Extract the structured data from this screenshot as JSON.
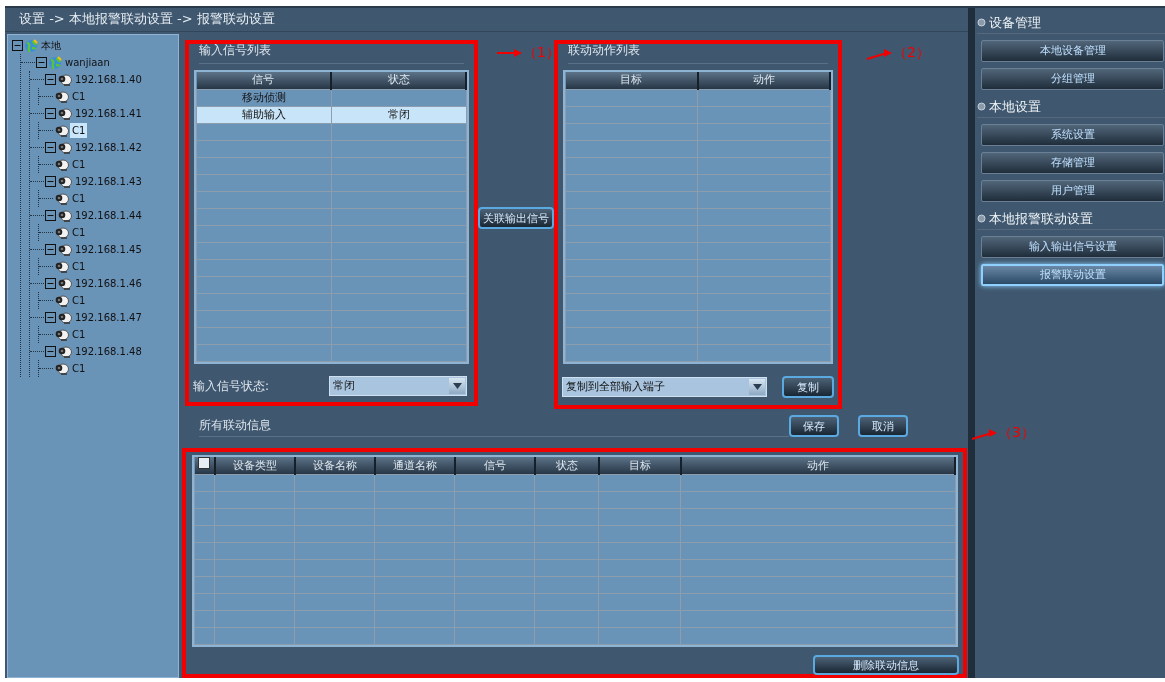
{
  "breadcrumb": "设置 -> 本地报警联动设置 -> 报警联动设置",
  "tree": [
    {
      "label": "本地",
      "kind": "site",
      "expanded": true,
      "selected": false,
      "children": [
        {
          "label": "wanjiaan",
          "kind": "site",
          "expanded": true,
          "selected": false,
          "children": [
            {
              "label": "192.168.1.40",
              "kind": "device",
              "expanded": true,
              "selected": false,
              "children": [
                {
                  "label": "C1",
                  "kind": "channel",
                  "selected": false
                }
              ]
            },
            {
              "label": "192.168.1.41",
              "kind": "device",
              "expanded": true,
              "selected": false,
              "children": [
                {
                  "label": "C1",
                  "kind": "channel",
                  "selected": true
                }
              ]
            },
            {
              "label": "192.168.1.42",
              "kind": "device",
              "expanded": true,
              "selected": false,
              "children": [
                {
                  "label": "C1",
                  "kind": "channel",
                  "selected": false
                }
              ]
            },
            {
              "label": "192.168.1.43",
              "kind": "device",
              "expanded": true,
              "selected": false,
              "children": [
                {
                  "label": "C1",
                  "kind": "channel",
                  "selected": false
                }
              ]
            },
            {
              "label": "192.168.1.44",
              "kind": "device",
              "expanded": true,
              "selected": false,
              "children": [
                {
                  "label": "C1",
                  "kind": "channel",
                  "selected": false
                }
              ]
            },
            {
              "label": "192.168.1.45",
              "kind": "device",
              "expanded": true,
              "selected": false,
              "children": [
                {
                  "label": "C1",
                  "kind": "channel",
                  "selected": false
                }
              ]
            },
            {
              "label": "192.168.1.46",
              "kind": "device",
              "expanded": true,
              "selected": false,
              "children": [
                {
                  "label": "C1",
                  "kind": "channel",
                  "selected": false
                }
              ]
            },
            {
              "label": "192.168.1.47",
              "kind": "device",
              "expanded": true,
              "selected": false,
              "children": [
                {
                  "label": "C1",
                  "kind": "channel",
                  "selected": false
                }
              ]
            },
            {
              "label": "192.168.1.48",
              "kind": "device",
              "expanded": true,
              "selected": false,
              "children": [
                {
                  "label": "C1",
                  "kind": "channel",
                  "selected": false
                }
              ]
            }
          ]
        }
      ]
    }
  ],
  "input_panel": {
    "title": "输入信号列表",
    "columns": [
      "信号",
      "状态"
    ],
    "rows": [
      {
        "signal": "移动侦测",
        "selected": false
      },
      {
        "signal": "辅助输入",
        "state": "常闭",
        "selected": true
      }
    ],
    "status_label": "输入信号状态:",
    "status_value": "常闭"
  },
  "link_button": "关联输出信号",
  "action_panel": {
    "title": "联动动作列表",
    "columns": [
      "目标",
      "动作"
    ],
    "copy_value": "复制到全部输入端子",
    "copy_button": "复制"
  },
  "summary": {
    "title": "所有联动信息",
    "save_button": "保存",
    "cancel_button": "取消",
    "select_all_checked": false,
    "columns": [
      "设备类型",
      "设备名称",
      "通道名称",
      "信号",
      "状态",
      "目标",
      "动作"
    ],
    "delete_button": "删除联动信息"
  },
  "sidebar": [
    {
      "heading": "设备管理",
      "items": [
        {
          "label": "本地设备管理",
          "selected": false
        },
        {
          "label": "分组管理",
          "selected": false
        }
      ]
    },
    {
      "heading": "本地设置",
      "items": [
        {
          "label": "系统设置",
          "selected": false
        },
        {
          "label": "存储管理",
          "selected": false
        },
        {
          "label": "用户管理",
          "selected": false
        }
      ]
    },
    {
      "heading": "本地报警联动设置",
      "items": [
        {
          "label": "输入输出信号设置",
          "selected": false
        },
        {
          "label": "报警联动设置",
          "selected": true
        }
      ]
    }
  ],
  "annotations": [
    {
      "label": "（1）"
    },
    {
      "label": "（2）"
    },
    {
      "label": "（3）"
    }
  ]
}
